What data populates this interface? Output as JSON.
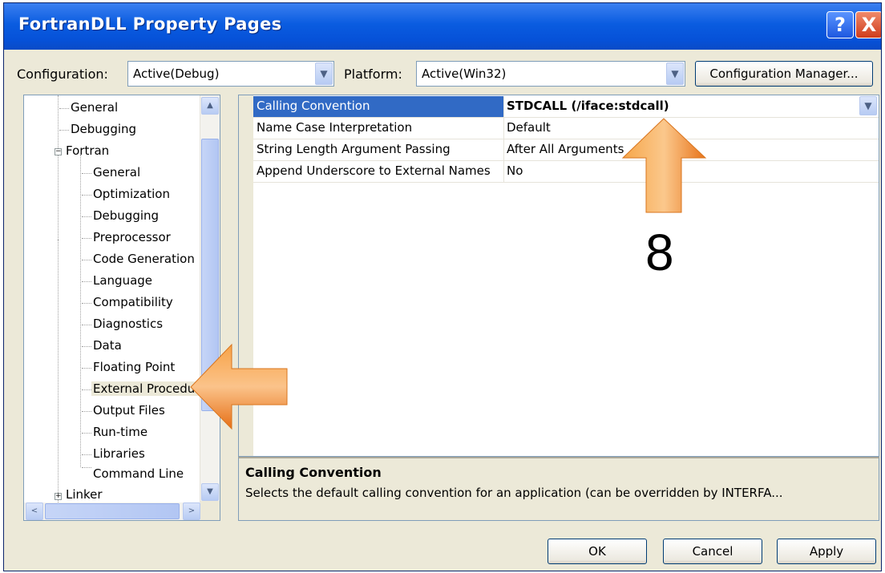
{
  "window": {
    "title": "FortranDLL Property Pages",
    "help_label": "?",
    "close_label": "X"
  },
  "config": {
    "configuration_label": "Configuration:",
    "configuration_value": "Active(Debug)",
    "platform_label": "Platform:",
    "platform_value": "Active(Win32)",
    "manager_button": "Configuration Manager..."
  },
  "tree": {
    "items": [
      {
        "label": "General"
      },
      {
        "label": "Debugging"
      },
      {
        "label": "Fortran"
      },
      {
        "label": "General"
      },
      {
        "label": "Optimization"
      },
      {
        "label": "Debugging"
      },
      {
        "label": "Preprocessor"
      },
      {
        "label": "Code Generation"
      },
      {
        "label": "Language"
      },
      {
        "label": "Compatibility"
      },
      {
        "label": "Diagnostics"
      },
      {
        "label": "Data"
      },
      {
        "label": "Floating Point"
      },
      {
        "label": "External Procedures"
      },
      {
        "label": "Output Files"
      },
      {
        "label": "Run-time"
      },
      {
        "label": "Libraries"
      },
      {
        "label": "Command Line"
      },
      {
        "label": "Linker"
      }
    ],
    "selected": "External Procedures",
    "scroll_left": "<",
    "scroll_right": ">",
    "scroll_up": "▲",
    "scroll_down": "▼"
  },
  "properties": {
    "rows": [
      {
        "name": "Calling Convention",
        "value": "STDCALL (/iface:stdcall)"
      },
      {
        "name": "Name Case Interpretation",
        "value": "Default"
      },
      {
        "name": "String Length Argument Passing",
        "value": "After All Arguments"
      },
      {
        "name": "Append Underscore to External Names",
        "value": "No"
      }
    ],
    "selected_index": 0,
    "dropdown_arrow": "▼"
  },
  "description": {
    "title": "Calling Convention",
    "text": "Selects the default calling convention for an application (can be overridden by INTERFA..."
  },
  "buttons": {
    "ok": "OK",
    "cancel": "Cancel",
    "apply": "Apply"
  },
  "annotations": {
    "step_number": "8",
    "arrow_color": "#f28a22"
  },
  "colors": {
    "titlebar": "#0651d8",
    "selection": "#316ac5",
    "dialog_bg": "#ece9d8"
  }
}
